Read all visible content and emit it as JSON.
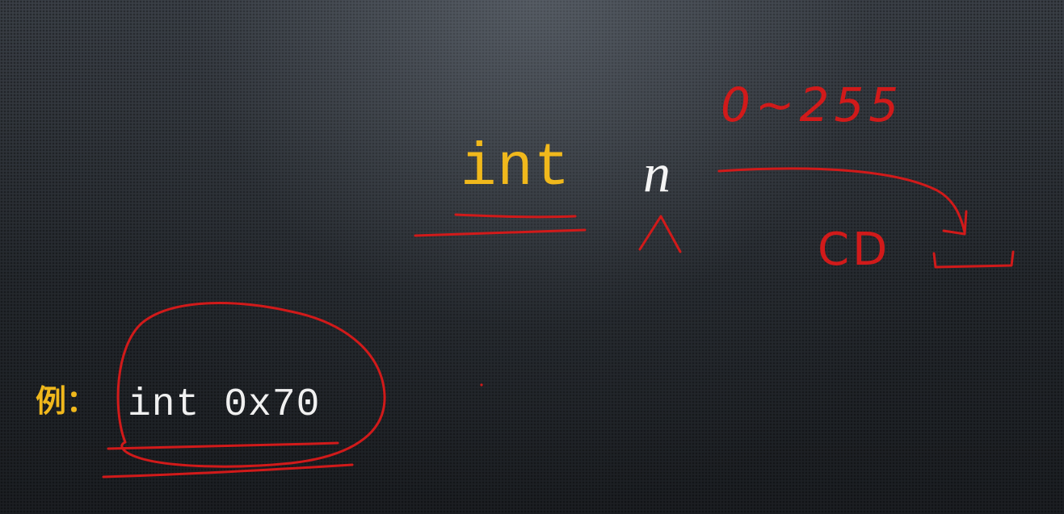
{
  "slide": {
    "declaration": {
      "keyword": "int",
      "variable": "n"
    },
    "example": {
      "label": "例：",
      "code": "int 0x70"
    },
    "handwritten": {
      "range_note": "0~255",
      "box_note": "CD"
    },
    "colors": {
      "background": "#2b2f34",
      "keyword": "#f0b81c",
      "code_text": "#f0f0f0",
      "ink": "#d11a1a"
    }
  }
}
